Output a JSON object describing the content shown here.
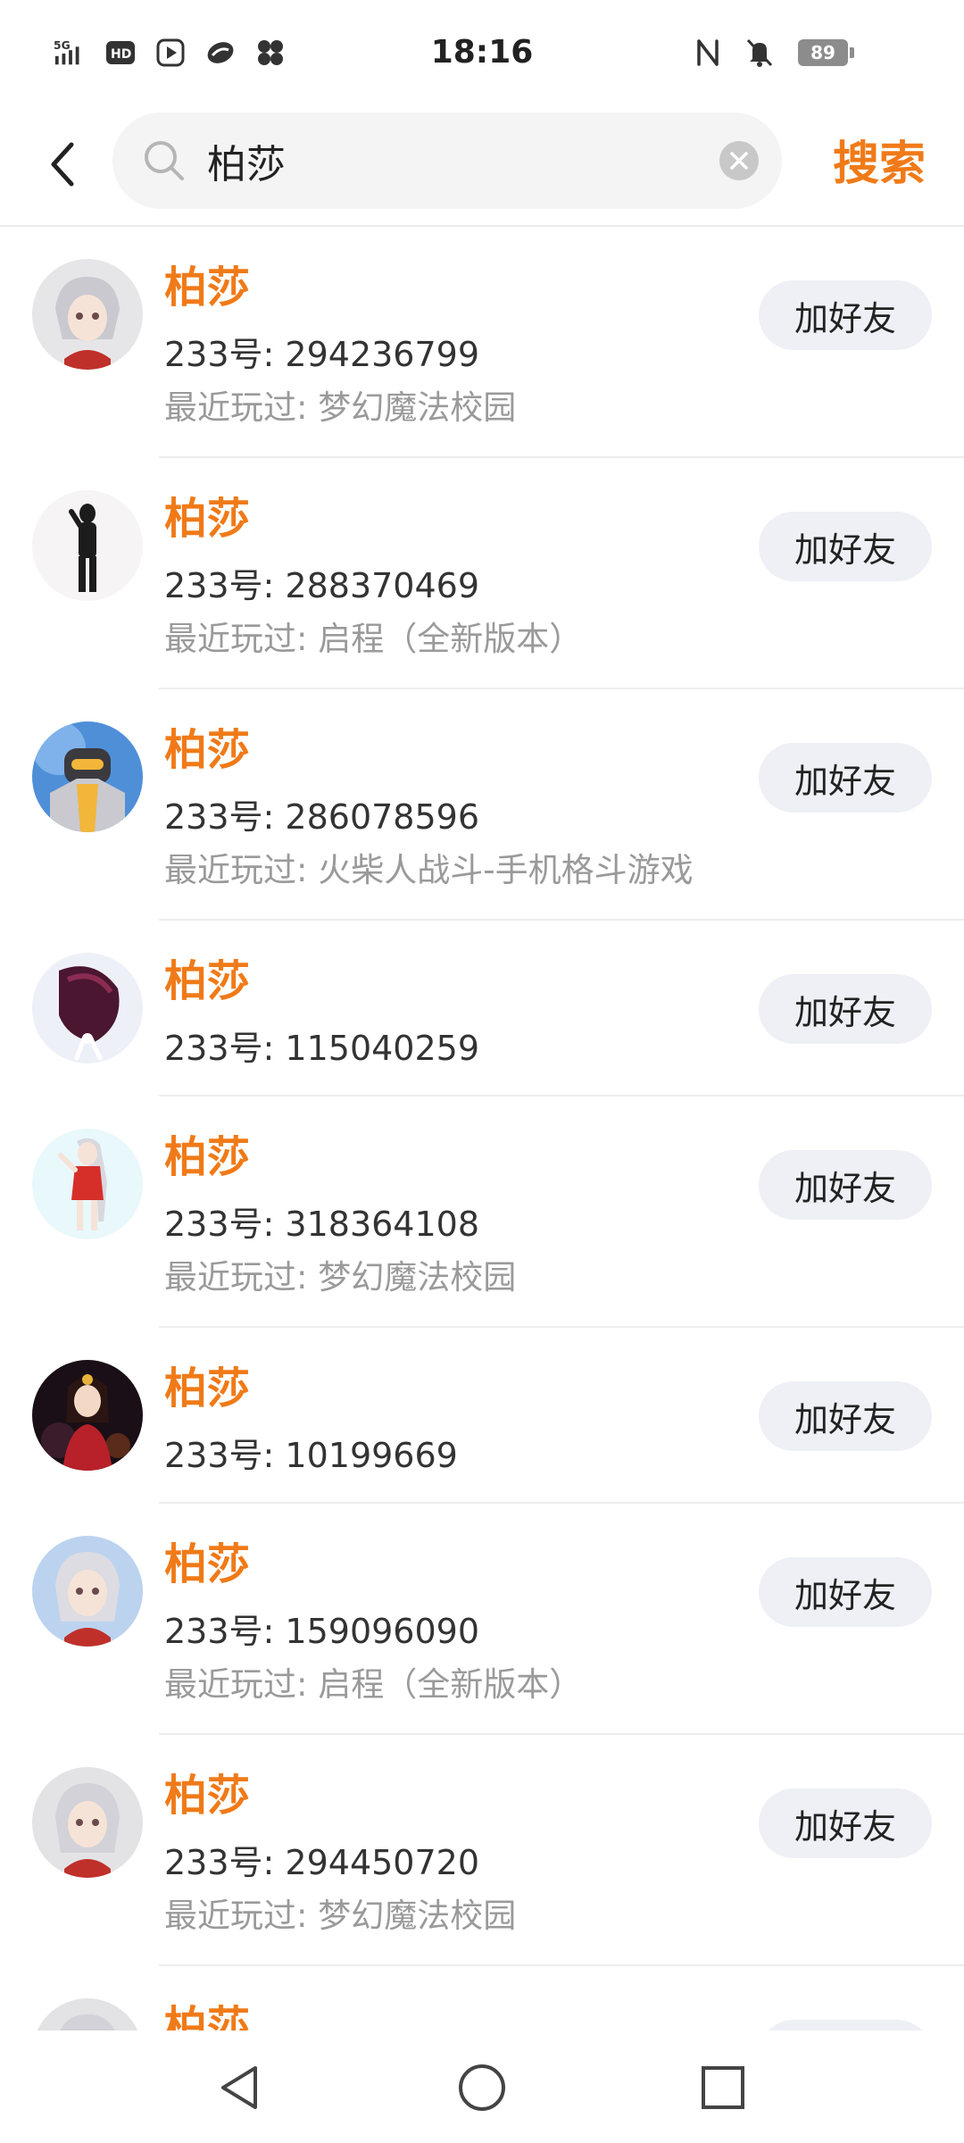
{
  "status_bar": {
    "time": "18:16",
    "battery": "89",
    "left_icons": [
      "5g-signal-icon",
      "hd-icon",
      "video-icon",
      "app-icon",
      "fan-icon"
    ],
    "right_icons": [
      "nfc-icon",
      "mute-icon"
    ]
  },
  "header": {
    "search_value": "柏莎",
    "search_button": "搜索"
  },
  "results": [
    {
      "name": "柏莎",
      "uid": "233号: 294236799",
      "recent": "最近玩过: 梦幻魔法校园",
      "action": "加好友"
    },
    {
      "name": "柏莎",
      "uid": "233号: 288370469",
      "recent": "最近玩过: 启程（全新版本）",
      "action": "加好友"
    },
    {
      "name": "柏莎",
      "uid": "233号: 286078596",
      "recent": "最近玩过: 火柴人战斗-手机格斗游戏",
      "action": "加好友"
    },
    {
      "name": "柏莎",
      "uid": "233号: 115040259",
      "recent": "",
      "action": "加好友"
    },
    {
      "name": "柏莎",
      "uid": "233号: 318364108",
      "recent": "最近玩过: 梦幻魔法校园",
      "action": "加好友"
    },
    {
      "name": "柏莎",
      "uid": "233号: 10199669",
      "recent": "",
      "action": "加好友"
    },
    {
      "name": "柏莎",
      "uid": "233号: 159096090",
      "recent": "最近玩过: 启程（全新版本）",
      "action": "加好友"
    },
    {
      "name": "柏莎",
      "uid": "233号: 294450720",
      "recent": "最近玩过: 梦幻魔法校园",
      "action": "加好友"
    },
    {
      "name": "柏莎",
      "uid": "",
      "recent": "",
      "action": ""
    }
  ],
  "colors": {
    "accent": "#f07a18",
    "button_bg": "#eef0f5",
    "secondary_text": "#9a9a9a"
  }
}
